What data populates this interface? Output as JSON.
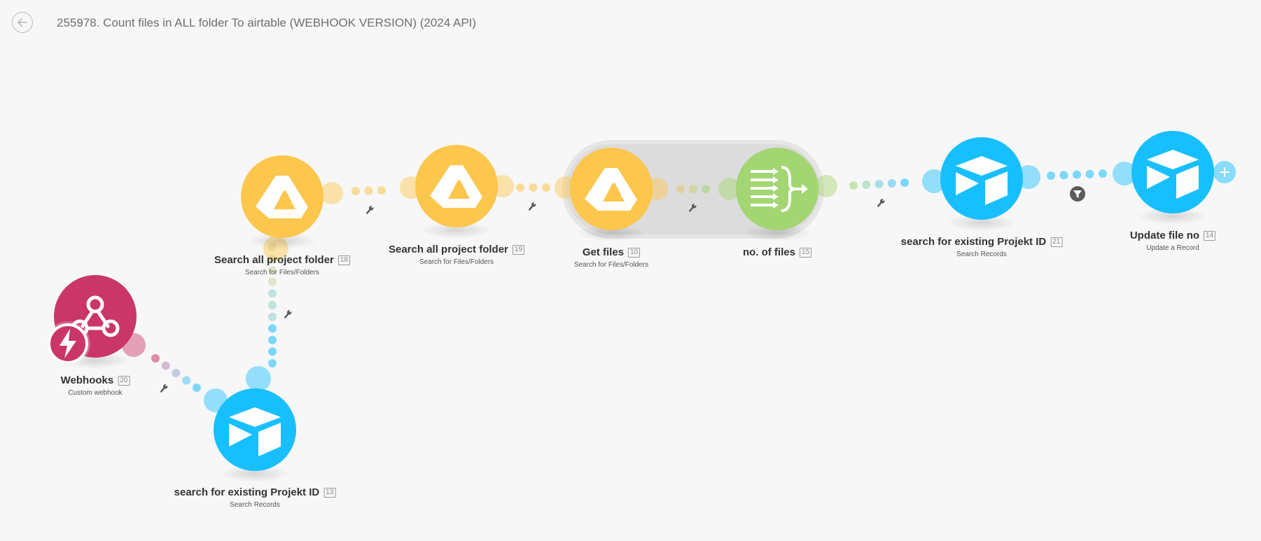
{
  "header": {
    "title": "255978. Count files in ALL folder To airtable (WEBHOOK VERSION) (2024 API)",
    "back_icon": "arrow-left-icon"
  },
  "colors": {
    "webhooks": "#c93667",
    "google_drive": "#fdc64c",
    "airtable": "#18bfff",
    "aggregator": "#a3d572",
    "background": "#f7f7f7",
    "router_group": "#dcdcdc"
  },
  "modules": [
    {
      "id": "20",
      "name": "Webhooks",
      "subtitle": "Custom webhook",
      "app": "webhooks",
      "icon": "webhook-icon",
      "trigger_icon": "instant-trigger-icon"
    },
    {
      "id": "13",
      "name": "search for existing Projekt ID",
      "subtitle": "Search Records",
      "app": "airtable",
      "icon": "airtable-icon"
    },
    {
      "id": "18",
      "name": "Search all project folder",
      "subtitle": "Search for Files/Folders",
      "app": "google_drive",
      "icon": "google-drive-icon"
    },
    {
      "id": "19",
      "name": "Search all project folder",
      "subtitle": "Search for Files/Folders",
      "app": "google_drive",
      "icon": "google-drive-icon"
    },
    {
      "id": "10",
      "name": "Get files",
      "subtitle": "Search for Files/Folders",
      "app": "google_drive",
      "icon": "google-drive-icon"
    },
    {
      "id": "15",
      "name": "no. of files",
      "subtitle": "",
      "app": "aggregator",
      "icon": "numeric-aggregator-icon"
    },
    {
      "id": "21",
      "name": "search for existing Projekt ID",
      "subtitle": "Search Records",
      "app": "airtable",
      "icon": "airtable-icon"
    },
    {
      "id": "14",
      "name": "Update file no",
      "subtitle": "Update a Record",
      "app": "airtable",
      "icon": "airtable-icon",
      "add_icon": "plus-icon"
    }
  ],
  "connections": [
    {
      "from": "20",
      "to": "13",
      "icon": "wrench-icon"
    },
    {
      "from": "13",
      "to": "18",
      "icon": "wrench-icon"
    },
    {
      "from": "18",
      "to": "19",
      "icon": "wrench-icon"
    },
    {
      "from": "19",
      "to": "10",
      "icon": "wrench-icon"
    },
    {
      "from": "10",
      "to": "15",
      "icon": "wrench-icon"
    },
    {
      "from": "15",
      "to": "21",
      "icon": "wrench-icon"
    },
    {
      "from": "21",
      "to": "14",
      "icon": "filter-icon"
    }
  ]
}
